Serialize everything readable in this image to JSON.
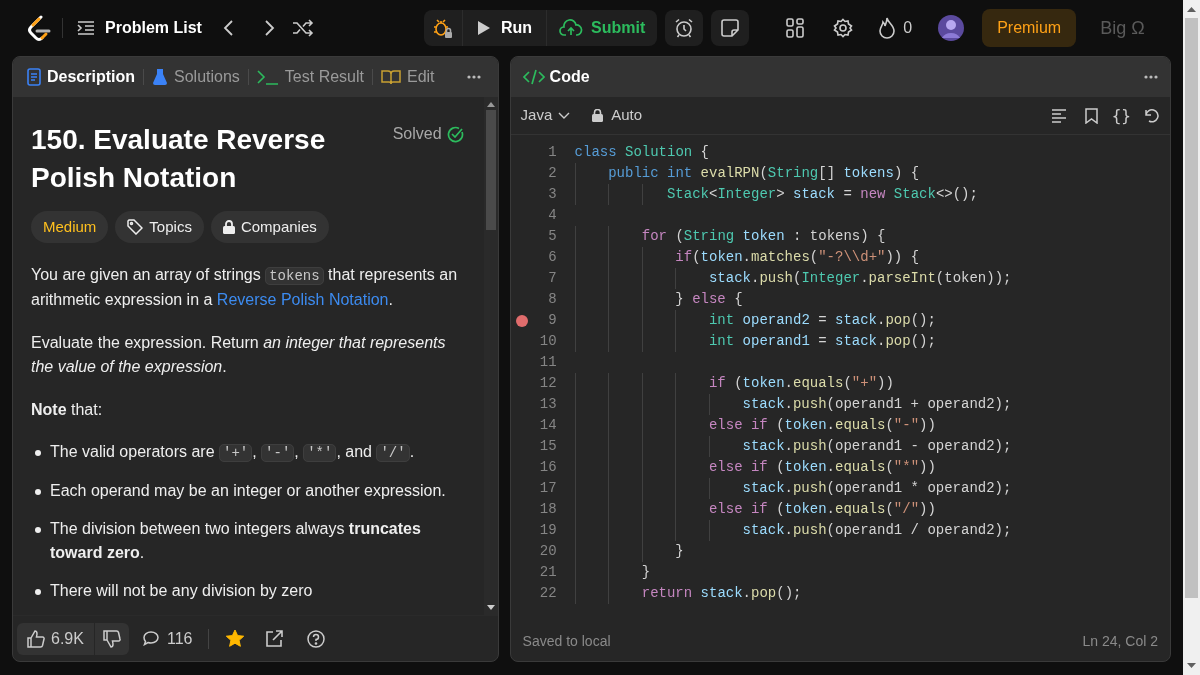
{
  "top_bar": {
    "problem_list": "Problem List",
    "run": "Run",
    "submit": "Submit",
    "streak": "0",
    "premium": "Premium",
    "brand": "Big Ω"
  },
  "left_panel": {
    "tabs": [
      {
        "label": "Description",
        "selected": true
      },
      {
        "label": "Solutions",
        "selected": false
      },
      {
        "label": "Test Result",
        "selected": false
      },
      {
        "label": "Edit",
        "selected": false
      }
    ],
    "title": "150. Evaluate Reverse Polish Notation",
    "status": "Solved",
    "tags": [
      {
        "label": "Medium",
        "kind": "difficulty"
      },
      {
        "label": "Topics",
        "kind": "tag"
      },
      {
        "label": "Companies",
        "kind": "lock"
      }
    ],
    "paragraphs": [
      [
        {
          "kind": "text",
          "text": "You are given an array of strings "
        },
        {
          "kind": "code",
          "text": "tokens"
        },
        {
          "kind": "text",
          "text": " that represents an arithmetic expression in a "
        },
        {
          "kind": "link",
          "text": "Reverse Polish Notation"
        },
        {
          "kind": "text",
          "text": "."
        }
      ],
      [
        {
          "kind": "text",
          "text": "Evaluate the expression. Return *an integer that represents the value of the expression*."
        }
      ],
      [
        {
          "kind": "text",
          "text": "**Note** that:"
        }
      ]
    ],
    "bullets": [
      [
        {
          "kind": "text",
          "text": "The valid operators are "
        },
        {
          "kind": "code",
          "text": "'+'"
        },
        {
          "kind": "text",
          "text": ", "
        },
        {
          "kind": "code",
          "text": "'-'"
        },
        {
          "kind": "text",
          "text": ", "
        },
        {
          "kind": "code",
          "text": "'*'"
        },
        {
          "kind": "text",
          "text": ", and "
        },
        {
          "kind": "code",
          "text": "'/'"
        },
        {
          "kind": "text",
          "text": "."
        }
      ],
      [
        {
          "kind": "text",
          "text": "Each operand may be an integer or another expression."
        }
      ],
      [
        {
          "kind": "text",
          "text": "The division between two integers always **truncates toward zero**."
        }
      ],
      [
        {
          "kind": "text",
          "text": "There will not be any division by zero"
        }
      ]
    ],
    "footer": {
      "likes": "6.9K",
      "comments": "116",
      "favorited": true
    }
  },
  "code_panel": {
    "title": "Code",
    "language": "Java",
    "mode": "Auto",
    "format_label": "{}",
    "lines": [
      {
        "number": "1",
        "breakpoint": false,
        "tokens": [
          {
            "kind": "keyword",
            "text": "class"
          },
          {
            "kind": "type",
            "text": " Solution"
          },
          {
            "kind": "plain",
            "text": " {"
          }
        ]
      },
      {
        "number": "2",
        "breakpoint": false,
        "tokens": [
          {
            "kind": "keyword",
            "text": "    public"
          },
          {
            "kind": "keyword",
            "text": " int"
          },
          {
            "kind": "function",
            "text": " evalRPN"
          },
          {
            "kind": "plain",
            "text": "("
          },
          {
            "kind": "type",
            "text": "String"
          },
          {
            "kind": "plain",
            "text": "[]"
          },
          {
            "kind": "variable",
            "text": " tokens"
          },
          {
            "kind": "plain",
            "text": ") {"
          }
        ]
      },
      {
        "number": "3",
        "breakpoint": false,
        "tokens": [
          {
            "kind": "type",
            "text": "           Stack"
          },
          {
            "kind": "plain",
            "text": "<"
          },
          {
            "kind": "type",
            "text": "Integer"
          },
          {
            "kind": "plain",
            "text": ">"
          },
          {
            "kind": "variable",
            "text": " stack"
          },
          {
            "kind": "plain",
            "text": " ="
          },
          {
            "kind": "control",
            "text": " new"
          },
          {
            "kind": "type",
            "text": " Stack"
          },
          {
            "kind": "plain",
            "text": "<>();"
          }
        ]
      },
      {
        "number": "4",
        "breakpoint": false
      },
      {
        "number": "5",
        "breakpoint": false,
        "tokens": [
          {
            "kind": "control",
            "text": "        for"
          },
          {
            "kind": "plain",
            "text": " ("
          },
          {
            "kind": "type",
            "text": "String"
          },
          {
            "kind": "variable",
            "text": " token"
          },
          {
            "kind": "plain",
            "text": " : tokens) {"
          }
        ]
      },
      {
        "number": "6",
        "breakpoint": false,
        "tokens": [
          {
            "kind": "control",
            "text": "            if"
          },
          {
            "kind": "plain",
            "text": "("
          },
          {
            "kind": "variable",
            "text": "token"
          },
          {
            "kind": "plain",
            "text": "."
          },
          {
            "kind": "function",
            "text": "matches"
          },
          {
            "kind": "plain",
            "text": "("
          },
          {
            "kind": "string",
            "text": "\"-?\\\\d+\""
          },
          {
            "kind": "plain",
            "text": ")) {"
          }
        ]
      },
      {
        "number": "7",
        "breakpoint": false,
        "tokens": [
          {
            "kind": "variable",
            "text": "                stack"
          },
          {
            "kind": "plain",
            "text": "."
          },
          {
            "kind": "function",
            "text": "push"
          },
          {
            "kind": "plain",
            "text": "("
          },
          {
            "kind": "type",
            "text": "Integer"
          },
          {
            "kind": "plain",
            "text": "."
          },
          {
            "kind": "function",
            "text": "parseInt"
          },
          {
            "kind": "plain",
            "text": "(token));"
          }
        ]
      },
      {
        "number": "8",
        "breakpoint": false,
        "tokens": [
          {
            "kind": "plain",
            "text": "            }"
          },
          {
            "kind": "control",
            "text": " else"
          },
          {
            "kind": "plain",
            "text": " {"
          }
        ]
      },
      {
        "number": "9",
        "breakpoint": true,
        "tokens": [
          {
            "kind": "type",
            "text": "                int"
          },
          {
            "kind": "variable",
            "text": " operand2"
          },
          {
            "kind": "plain",
            "text": " ="
          },
          {
            "kind": "variable",
            "text": " stack"
          },
          {
            "kind": "plain",
            "text": "."
          },
          {
            "kind": "function",
            "text": "pop"
          },
          {
            "kind": "plain",
            "text": "();"
          }
        ]
      },
      {
        "number": "10",
        "breakpoint": false,
        "tokens": [
          {
            "kind": "type",
            "text": "                int"
          },
          {
            "kind": "variable",
            "text": " operand1"
          },
          {
            "kind": "plain",
            "text": " ="
          },
          {
            "kind": "variable",
            "text": " stack"
          },
          {
            "kind": "plain",
            "text": "."
          },
          {
            "kind": "function",
            "text": "pop"
          },
          {
            "kind": "plain",
            "text": "();"
          }
        ]
      },
      {
        "number": "11",
        "breakpoint": false
      },
      {
        "number": "12",
        "breakpoint": false,
        "tokens": [
          {
            "kind": "control",
            "text": "                if"
          },
          {
            "kind": "plain",
            "text": " ("
          },
          {
            "kind": "variable",
            "text": "token"
          },
          {
            "kind": "plain",
            "text": "."
          },
          {
            "kind": "function",
            "text": "equals"
          },
          {
            "kind": "plain",
            "text": "("
          },
          {
            "kind": "string",
            "text": "\"+\""
          },
          {
            "kind": "plain",
            "text": "))"
          }
        ]
      },
      {
        "number": "13",
        "breakpoint": false,
        "tokens": [
          {
            "kind": "variable",
            "text": "                    stack"
          },
          {
            "kind": "plain",
            "text": "."
          },
          {
            "kind": "function",
            "text": "push"
          },
          {
            "kind": "plain",
            "text": "(operand1 + operand2);"
          }
        ]
      },
      {
        "number": "14",
        "breakpoint": false,
        "tokens": [
          {
            "kind": "control",
            "text": "                else if"
          },
          {
            "kind": "plain",
            "text": " ("
          },
          {
            "kind": "variable",
            "text": "token"
          },
          {
            "kind": "plain",
            "text": "."
          },
          {
            "kind": "function",
            "text": "equals"
          },
          {
            "kind": "plain",
            "text": "("
          },
          {
            "kind": "string",
            "text": "\"-\""
          },
          {
            "kind": "plain",
            "text": "))"
          }
        ]
      },
      {
        "number": "15",
        "breakpoint": false,
        "tokens": [
          {
            "kind": "variable",
            "text": "                    stack"
          },
          {
            "kind": "plain",
            "text": "."
          },
          {
            "kind": "function",
            "text": "push"
          },
          {
            "kind": "plain",
            "text": "(operand1 - operand2);"
          }
        ]
      },
      {
        "number": "16",
        "breakpoint": false,
        "tokens": [
          {
            "kind": "control",
            "text": "                else if"
          },
          {
            "kind": "plain",
            "text": " ("
          },
          {
            "kind": "variable",
            "text": "token"
          },
          {
            "kind": "plain",
            "text": "."
          },
          {
            "kind": "function",
            "text": "equals"
          },
          {
            "kind": "plain",
            "text": "("
          },
          {
            "kind": "string",
            "text": "\"*\""
          },
          {
            "kind": "plain",
            "text": "))"
          }
        ]
      },
      {
        "number": "17",
        "breakpoint": false,
        "tokens": [
          {
            "kind": "variable",
            "text": "                    stack"
          },
          {
            "kind": "plain",
            "text": "."
          },
          {
            "kind": "function",
            "text": "push"
          },
          {
            "kind": "plain",
            "text": "(operand1 * operand2);"
          }
        ]
      },
      {
        "number": "18",
        "breakpoint": false,
        "tokens": [
          {
            "kind": "control",
            "text": "                else if"
          },
          {
            "kind": "plain",
            "text": " ("
          },
          {
            "kind": "variable",
            "text": "token"
          },
          {
            "kind": "plain",
            "text": "."
          },
          {
            "kind": "function",
            "text": "equals"
          },
          {
            "kind": "plain",
            "text": "("
          },
          {
            "kind": "string",
            "text": "\"/\""
          },
          {
            "kind": "plain",
            "text": "))"
          }
        ]
      },
      {
        "number": "19",
        "breakpoint": false,
        "tokens": [
          {
            "kind": "variable",
            "text": "                    stack"
          },
          {
            "kind": "plain",
            "text": "."
          },
          {
            "kind": "function",
            "text": "push"
          },
          {
            "kind": "plain",
            "text": "(operand1 / operand2);"
          }
        ]
      },
      {
        "number": "20",
        "breakpoint": false,
        "tokens": [
          {
            "kind": "plain",
            "text": "            }"
          }
        ]
      },
      {
        "number": "21",
        "breakpoint": false,
        "tokens": [
          {
            "kind": "plain",
            "text": "        }"
          }
        ]
      },
      {
        "number": "22",
        "breakpoint": false,
        "tokens": [
          {
            "kind": "control",
            "text": "        return"
          },
          {
            "kind": "variable",
            "text": " stack"
          },
          {
            "kind": "plain",
            "text": "."
          },
          {
            "kind": "function",
            "text": "pop"
          },
          {
            "kind": "plain",
            "text": "();"
          }
        ]
      }
    ],
    "status": "Saved to local",
    "cursor": "Ln 24, Col 2"
  }
}
